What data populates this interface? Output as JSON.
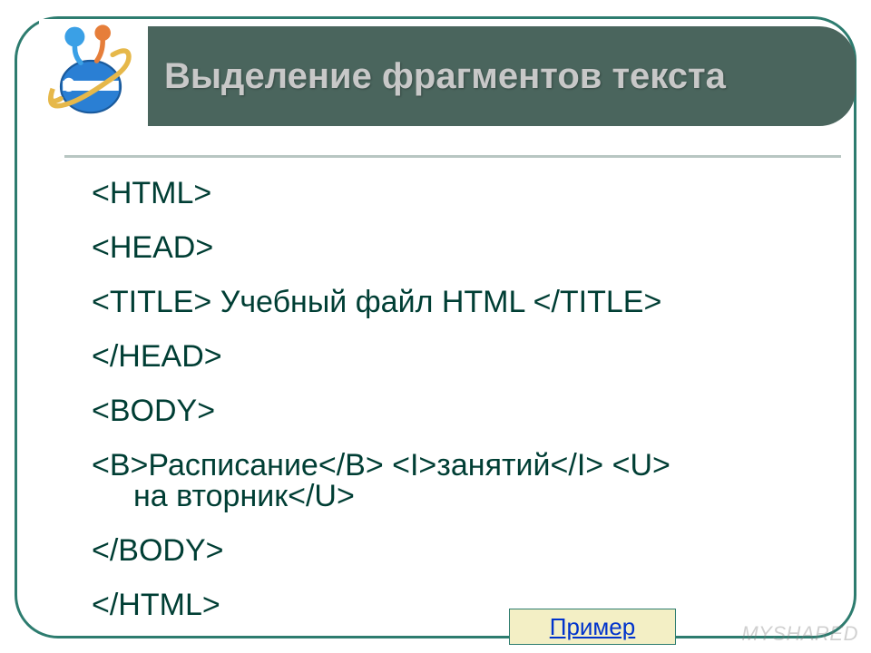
{
  "header": {
    "title": "Выделение фрагментов текста"
  },
  "code": {
    "l1": "<HTML>",
    "l2": "<HEAD>",
    "l3a": "<TITLE> ",
    "l3b": "Учебный файл HTML ",
    "l3c": "</TITLE>",
    "l4": "</HEAD>",
    "l5": "<BODY>",
    "l6a": "<B>",
    "l6b": "Расписание",
    "l6c": "</B> <I>",
    "l6d": "занятий",
    "l6e": "</I> <U> ",
    "l6f_indent": "на вторник",
    "l6g": "</U>",
    "l7": "</BODY>",
    "l8": "</HTML>"
  },
  "link": {
    "label": "Пример"
  },
  "watermark": "MYSHARED"
}
